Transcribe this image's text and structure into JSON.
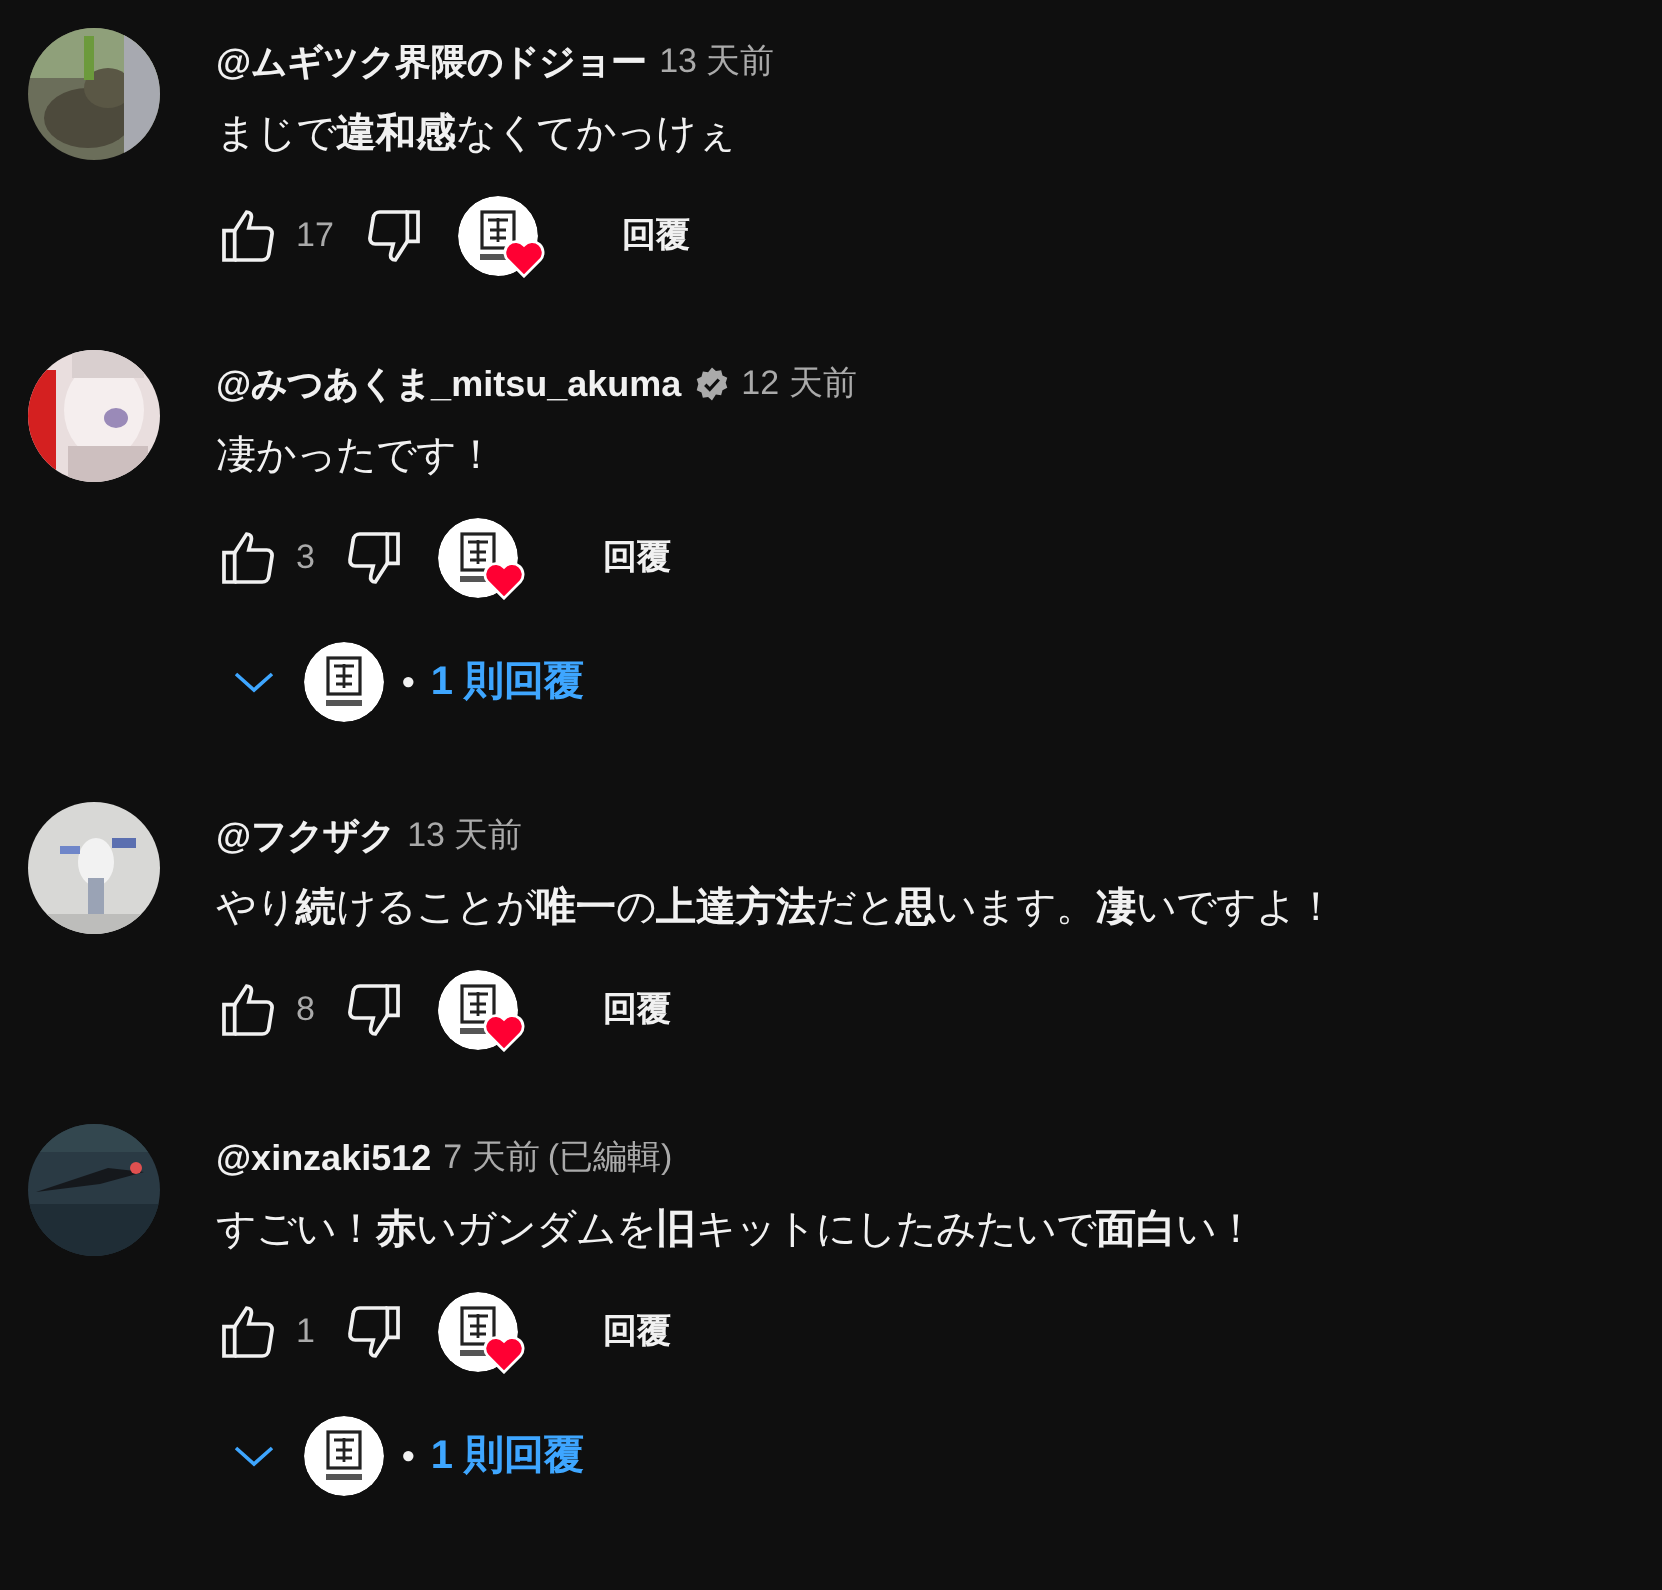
{
  "comments": [
    {
      "author": "@ムギツク界隈のドジョー",
      "verified": false,
      "time": "13 天前",
      "body": "まじで**違和感**なくてかっけぇ",
      "likes": "17",
      "creator_hearted": true,
      "reply_action": "回覆"
    },
    {
      "author": "@みつあくま_mitsu_akuma",
      "verified": true,
      "time": "12 天前",
      "body": "凄かったです！",
      "likes": "3",
      "creator_hearted": true,
      "reply_action": "回覆",
      "replies": {
        "label": "1 則回覆",
        "separator": "•"
      }
    },
    {
      "author": "@フクザク",
      "verified": false,
      "time": "13 天前",
      "body": "やり**続**けることが**唯一**の**上達方法**だと**思**います。**凄**いですよ！",
      "likes": "8",
      "creator_hearted": true,
      "reply_action": "回覆"
    },
    {
      "author": "@xinzaki512",
      "verified": false,
      "time": "7 天前",
      "edited": "(已編輯)",
      "body": "すごい！**赤**いガンダムを**旧**キットにしたみたいで**面白**い！",
      "likes": "1",
      "creator_hearted": true,
      "reply_action": "回覆",
      "replies": {
        "label": "1 則回覆",
        "separator": "•"
      }
    }
  ]
}
